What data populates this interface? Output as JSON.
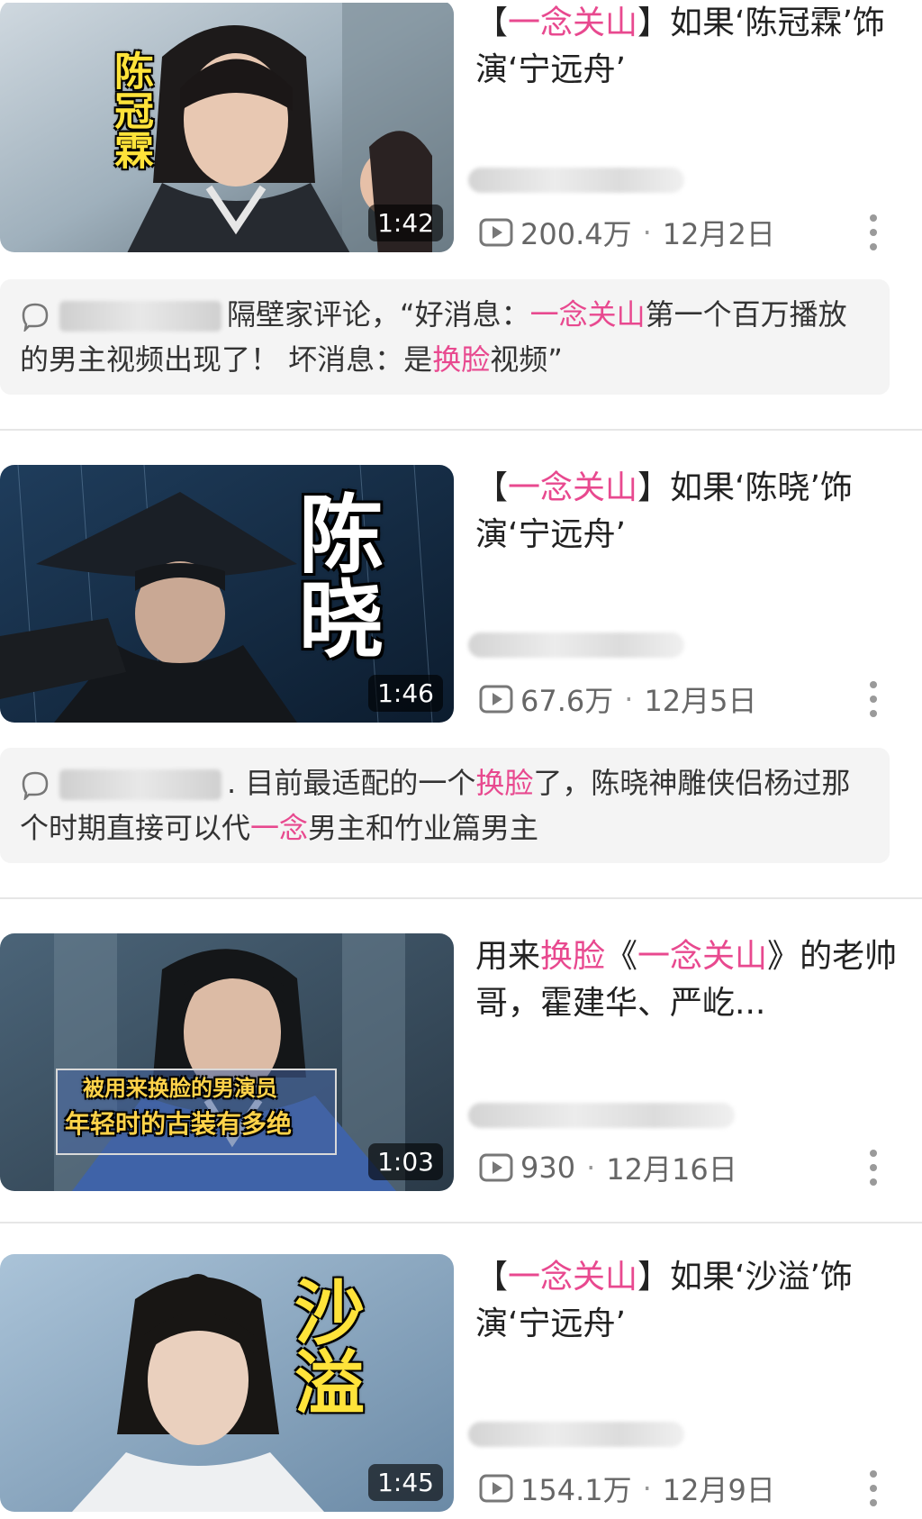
{
  "colors": {
    "highlight": "#e8498f",
    "meta_text": "#666666",
    "comment_bg": "#f4f4f4",
    "caption_yellow": "#ffe33a"
  },
  "videos": [
    {
      "thumb_caption": "陈冠霖",
      "duration": "1:42",
      "title": {
        "pre": "【",
        "hl1": "一念关山",
        "mid": "】如果‘陈冠霖’饰演‘宁远舟’",
        "hl2": "",
        "post": ""
      },
      "views": "200.4万",
      "date": "12月2日",
      "comment": {
        "pre": "隔壁家评论，“好消息：",
        "hl1": "一念关山",
        "mid": "第一个百万播放的男主视频出现了！ 坏消息：是",
        "hl2": "换脸",
        "post": "视频”"
      }
    },
    {
      "thumb_caption": "陈晓",
      "duration": "1:46",
      "title": {
        "pre": "【",
        "hl1": "一念关山",
        "mid": "】如果‘陈晓’饰演‘宁远舟’",
        "hl2": "",
        "post": ""
      },
      "views": "67.6万",
      "date": "12月5日",
      "comment": {
        "pre": ". 目前最适配的一个",
        "hl1": "换脸",
        "mid": "了，陈晓神雕侠侣杨过那个时期直接可以代",
        "hl2": "一念",
        "post": "男主和竹业篇男主"
      }
    },
    {
      "thumb_caption_line1": "被用来换脸的男演员",
      "thumb_caption_line2": "年轻时的古装有多绝",
      "duration": "1:03",
      "title": {
        "pre": "用来",
        "hl1": "换脸",
        "mid": "《",
        "hl2": "一念关山",
        "post": "》的老帅哥，霍建华、严屹..."
      },
      "views": "930",
      "date": "12月16日"
    },
    {
      "thumb_caption": "沙溢",
      "duration": "1:45",
      "title": {
        "pre": "【",
        "hl1": "一念关山",
        "mid": "】如果‘沙溢’饰演‘宁远舟’",
        "hl2": "",
        "post": ""
      },
      "views": "154.1万",
      "date": "12月9日"
    }
  ]
}
